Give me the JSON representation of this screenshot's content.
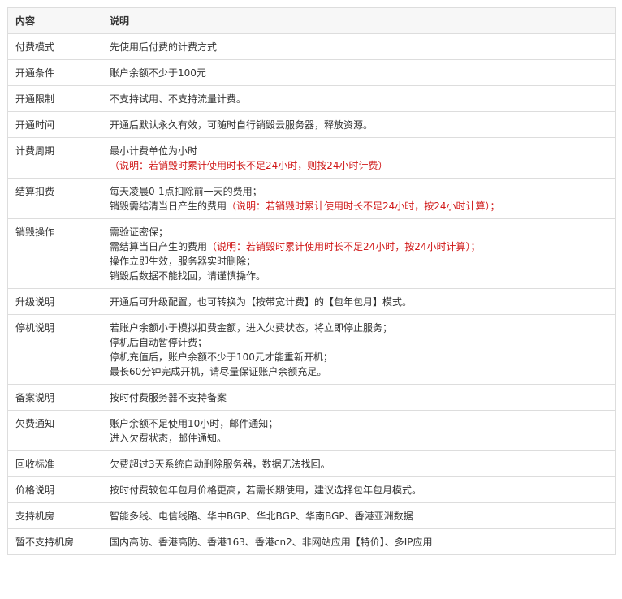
{
  "header": {
    "col1": "内容",
    "col2": "说明"
  },
  "rows": [
    {
      "label": "付费模式",
      "lines": [
        {
          "parts": [
            {
              "text": "先使用后付费的计费方式"
            }
          ]
        }
      ]
    },
    {
      "label": "开通条件",
      "lines": [
        {
          "parts": [
            {
              "text": "账户余额不少于100元"
            }
          ]
        }
      ]
    },
    {
      "label": "开通限制",
      "lines": [
        {
          "parts": [
            {
              "text": "不支持试用、不支持流量计费。"
            }
          ]
        }
      ]
    },
    {
      "label": "开通时间",
      "lines": [
        {
          "parts": [
            {
              "text": "开通后默认永久有效，可随时自行销毁云服务器，释放资源。"
            }
          ]
        }
      ]
    },
    {
      "label": "计费周期",
      "lines": [
        {
          "parts": [
            {
              "text": "最小计费单位为小时"
            }
          ]
        },
        {
          "parts": [
            {
              "text": "（说明：若销毁时累计使用时长不足24小时，则按24小时计费）",
              "red": true
            }
          ]
        }
      ]
    },
    {
      "label": "结算扣费",
      "lines": [
        {
          "parts": [
            {
              "text": "每天凌晨0-1点扣除前一天的费用；"
            }
          ]
        },
        {
          "parts": [
            {
              "text": "销毁需结清当日产生的费用"
            },
            {
              "text": "（说明：若销毁时累计使用时长不足24小时，按24小时计算）；",
              "red": true
            }
          ]
        }
      ]
    },
    {
      "label": "销毁操作",
      "lines": [
        {
          "parts": [
            {
              "text": "需验证密保；"
            }
          ]
        },
        {
          "parts": [
            {
              "text": "需结算当日产生的费用"
            },
            {
              "text": "（说明：若销毁时累计使用时长不足24小时，按24小时计算）；",
              "red": true
            }
          ]
        },
        {
          "parts": [
            {
              "text": "操作立即生效，服务器实时删除；"
            }
          ]
        },
        {
          "parts": [
            {
              "text": "销毁后数据不能找回，请谨慎操作。"
            }
          ]
        }
      ]
    },
    {
      "label": "升级说明",
      "lines": [
        {
          "parts": [
            {
              "text": "开通后可升级配置，也可转换为【按带宽计费】的【包年包月】模式。"
            }
          ]
        }
      ]
    },
    {
      "label": "停机说明",
      "lines": [
        {
          "parts": [
            {
              "text": "若账户余额小于模拟扣费金额，进入欠费状态，将立即停止服务；"
            }
          ]
        },
        {
          "parts": [
            {
              "text": "停机后自动暂停计费；"
            }
          ]
        },
        {
          "parts": [
            {
              "text": "停机充值后，账户余额不少于100元才能重新开机；"
            }
          ]
        },
        {
          "parts": [
            {
              "text": "最长60分钟完成开机，请尽量保证账户余额充足。"
            }
          ]
        }
      ]
    },
    {
      "label": "备案说明",
      "lines": [
        {
          "parts": [
            {
              "text": "按时付费服务器不支持备案"
            }
          ]
        }
      ]
    },
    {
      "label": "欠费通知",
      "lines": [
        {
          "parts": [
            {
              "text": "账户余额不足使用10小时，邮件通知；"
            }
          ]
        },
        {
          "parts": [
            {
              "text": "进入欠费状态，邮件通知。"
            }
          ]
        }
      ]
    },
    {
      "label": "回收标准",
      "lines": [
        {
          "parts": [
            {
              "text": "欠费超过3天系统自动删除服务器，数据无法找回。"
            }
          ]
        }
      ]
    },
    {
      "label": "价格说明",
      "lines": [
        {
          "parts": [
            {
              "text": "按时付费较包年包月价格更高，若需长期使用，建议选择包年包月模式。"
            }
          ]
        }
      ]
    },
    {
      "label": "支持机房",
      "lines": [
        {
          "parts": [
            {
              "text": "智能多线、电信线路、华中BGP、华北BGP、华南BGP、香港亚洲数据"
            }
          ]
        }
      ]
    },
    {
      "label": "暂不支持机房",
      "lines": [
        {
          "parts": [
            {
              "text": "国内高防、香港高防、香港163、香港cn2、非网站应用【特价】、多IP应用"
            }
          ]
        }
      ]
    }
  ],
  "colors": {
    "text": "#333333",
    "note": "#d01818",
    "border": "#dddddd",
    "header_bg": "#f7f7f7"
  }
}
